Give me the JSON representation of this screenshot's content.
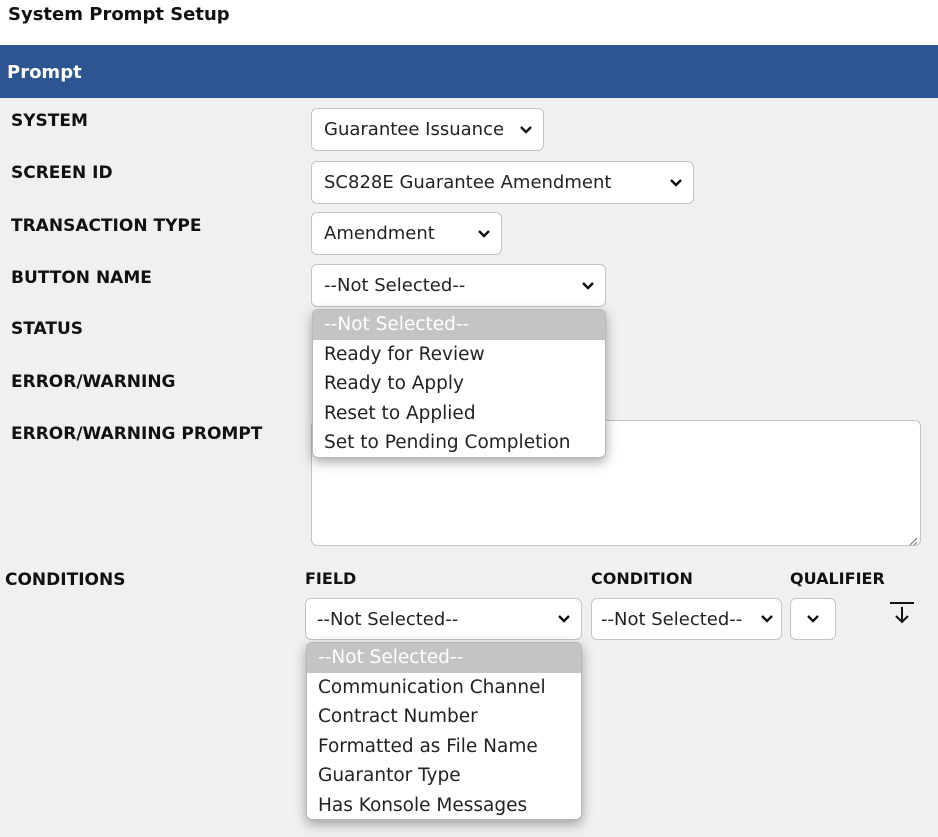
{
  "page": {
    "title": "System Prompt Setup"
  },
  "section": {
    "title": "Prompt"
  },
  "form": {
    "system": {
      "label": "SYSTEM",
      "value": "Guarantee Issuance"
    },
    "screen_id": {
      "label": "SCREEN ID",
      "value": "SC828E Guarantee Amendment"
    },
    "transaction_type": {
      "label": "TRANSACTION TYPE",
      "value": "Amendment"
    },
    "button_name": {
      "label": "BUTTON NAME",
      "value": "--Not Selected--",
      "options": [
        "--Not Selected--",
        "Ready for Review",
        "Ready to Apply",
        "Reset to Applied",
        "Set to Pending Completion"
      ]
    },
    "status": {
      "label": "STATUS"
    },
    "error_warning": {
      "label": "ERROR/WARNING"
    },
    "error_warning_prompt": {
      "label": "ERROR/WARNING PROMPT",
      "value": ""
    }
  },
  "conditions": {
    "label": "CONDITIONS",
    "field": {
      "header": "FIELD",
      "value": "--Not Selected--",
      "options": [
        "--Not Selected--",
        "Communication Channel",
        "Contract Number",
        "Formatted as File Name",
        "Guarantor Type",
        "Has Konsole Messages"
      ]
    },
    "condition": {
      "header": "CONDITION",
      "value": "--Not Selected--"
    },
    "qualifier": {
      "header": "QUALIFIER",
      "value": ""
    },
    "add_icon": "arrow-down-to-line-icon"
  },
  "colors": {
    "header_bg": "#2d5591",
    "page_bg": "#f0f0f0",
    "selected_option_bg": "#c4c4c4"
  }
}
